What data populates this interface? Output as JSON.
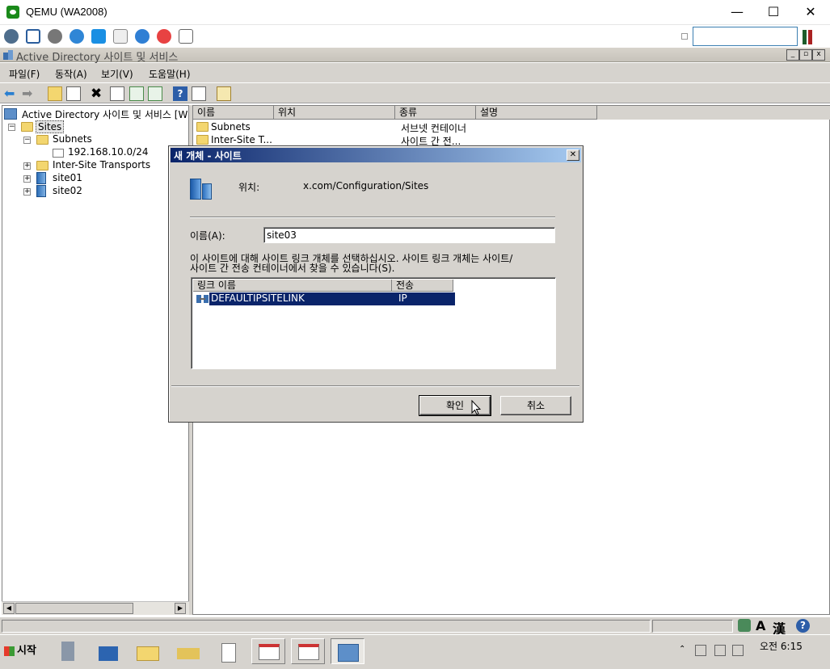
{
  "qemu": {
    "title": "QEMU (WA2008)",
    "minimize": "—",
    "maximize": "☐",
    "close": "✕"
  },
  "mmc": {
    "caption": "Active Directory 사이트 및 서비스",
    "menu": [
      "파일(F)",
      "동작(A)",
      "보기(V)",
      "도움말(H)"
    ]
  },
  "tree": {
    "root": "Active Directory 사이트 및 서비스 [W",
    "sites": "Sites",
    "subnets": "Subnets",
    "subnet_item": "192.168.10.0/24",
    "inter_site": "Inter-Site Transports",
    "site01": "site01",
    "site02": "site02"
  },
  "list": {
    "columns": [
      "이름",
      "위치",
      "종류",
      "설명"
    ],
    "rows": [
      {
        "name": "Subnets",
        "type": "서브넷 컨테이너"
      },
      {
        "name": "Inter-Site T...",
        "type": "사이트 간 전..."
      }
    ]
  },
  "dialog": {
    "title": "새 개체 - 사이트",
    "location_label": "위치:",
    "location_value": "x.com/Configuration/Sites",
    "name_label": "이름(A):",
    "name_value": "site03",
    "instruction_line1": "이 사이트에 대해 사이트 링크 개체를 선택하십시오. 사이트 링크 개체는 사이트/",
    "instruction_line2": "사이트 간 전송 컨테이너에서 찾을 수 있습니다(S).",
    "link_columns": [
      "링크 이름",
      "전송"
    ],
    "link_name": "DEFAULTIPSITELINK",
    "link_transport": "IP",
    "ok_label": "확인",
    "cancel_label": "취소",
    "close_glyph": "✕"
  },
  "taskbar": {
    "start_label": "시작",
    "time": "오전 6:15"
  },
  "tray": {
    "ime_a": "A",
    "ime_han": "漢"
  },
  "colors": {
    "selection": "#0a246a",
    "chrome": "#d6d3ce"
  }
}
